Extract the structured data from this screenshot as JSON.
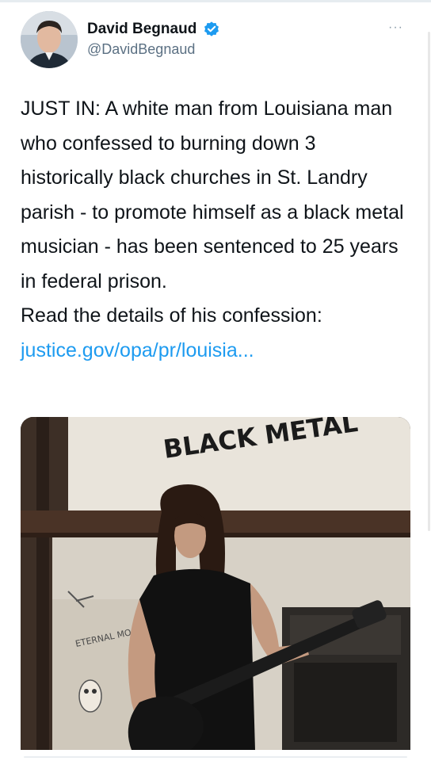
{
  "author": {
    "display_name": "David Begnaud",
    "handle": "@DavidBegnaud",
    "verified_icon": "verified-badge-icon",
    "avatar_icon": "profile-photo"
  },
  "menu": {
    "more_label": "···"
  },
  "tweet": {
    "text": "JUST IN: A white man from Louisiana man who confessed to burning down 3 historically black churches in St. Landry parish - to promote himself as a black metal musician - has been sentenced to 25 years in federal prison.\nRead the details of his confession:",
    "link_text": "justice.gov/opa/pr/louisia..."
  },
  "media": {
    "wall_text": "BLACK METAL",
    "poster_text": "ETERNAL MOAN"
  },
  "colors": {
    "link": "#1d9bf0",
    "verified": "#1d9bf0",
    "secondary_text": "#5b7083"
  }
}
